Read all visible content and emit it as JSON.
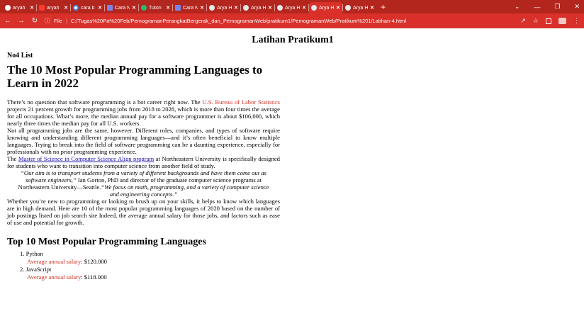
{
  "browser": {
    "tabs": [
      {
        "label": "aryah",
        "icon": "github-icon",
        "active": false
      },
      {
        "label": "aryah",
        "icon": "youtube-icon",
        "active": false
      },
      {
        "label": "cara b",
        "icon": "google-icon",
        "active": false
      },
      {
        "label": "Cara N",
        "icon": "teams-icon",
        "active": false
      },
      {
        "label": "Tutori",
        "icon": "tutorial-icon",
        "active": false
      },
      {
        "label": "Cara N",
        "icon": "outlook-icon",
        "active": false
      },
      {
        "label": "Arya H",
        "icon": "globe-icon",
        "active": false
      },
      {
        "label": "Arya H",
        "icon": "globe-icon",
        "active": false
      },
      {
        "label": "Arya H",
        "icon": "globe-icon",
        "active": false
      },
      {
        "label": "Arya H",
        "icon": "globe-icon",
        "active": true
      },
      {
        "label": "Arya H",
        "icon": "globe-icon",
        "active": false
      }
    ],
    "new_tab": "+",
    "file_label": "File",
    "url": "C:/Tugas%20Pa%20Feb/PemogramanPerangkatBergerak_dan_PemogramanWeb/pratikum1/PemogramanWeb/Pratikum%201/Latihan-4.html",
    "colors": {
      "chrome": "#d9302a",
      "tabbar": "#b3261e"
    }
  },
  "page": {
    "title": "Latihan Pratikum1",
    "subheading": "No4 List",
    "heading": "The 10 Most Popular Programming Languages to Learn in 2022",
    "p1_before": "There’s no question that software programming is a hot career right now. The ",
    "p1_link": "U.S. Bureau of Labor Statistics",
    "p1_after": " projects 21 percent growth for programming jobs from 2018 to 2028, which is more than four times the average for all occupations. What’s more, the median annual pay for a software programmer is about $106,000, which nearly three times the median pay for all U.S. workers.",
    "p2": "Not all programming jobs are the same, however. Different roles, companies, and types of software require knowing and understanding different programming languages—and it’s often beneficial to know multiple languages. Trying to break into the field of software programming can be a daunting experience, especially for professionals with no prior programming experience.",
    "p3_before": "The ",
    "p3_link": "Master of Science in Computer Science Align program",
    "p3_after": " at Northeastern University is specifically designed for students who want to transition into computer science from another field of study.",
    "quote1": "“Our aim is to transport students from a variety of different backgrounds and have them come out as software engineers,”",
    "quote_mid": " Ian Gorton, PhD and director of the graduate computer science programs at Northeastern University—Seattle.",
    "quote2": "“We focus on math, programming, and a variety of computer science and engineering concepts.”",
    "p4": "Whether you’re new to programming or looking to brush up on your skills, it helps to know which languages are in high demand. Here are 10 of the most popular programming languages of 2020 based on the number of job postings listed on job search site Indeed, the average annual salary for those jobs, and factors such as ease of use and potential for growth.",
    "list_heading": "Top 10 Most Popular Programming Languages",
    "salary_label": "Average annual salary",
    "languages": [
      {
        "num": "1.",
        "name": "Python",
        "salary": ": $120.000"
      },
      {
        "num": "2.",
        "name": "JavaScript",
        "salary": ": $118.000"
      }
    ]
  }
}
